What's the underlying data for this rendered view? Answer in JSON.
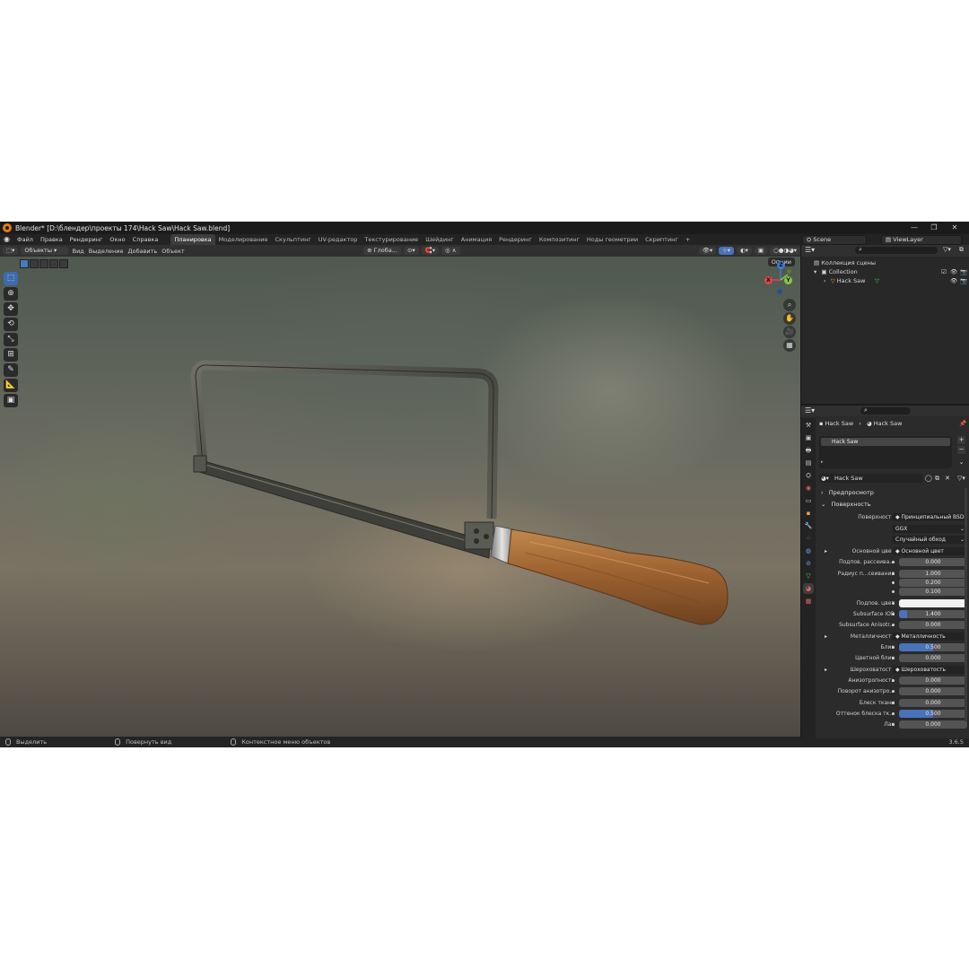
{
  "title": "Blender* [D:\\блендер\\проекты 174\\Hack Saw\\Hack Saw.blend]",
  "menu": [
    "Файл",
    "Правка",
    "Рендеринг",
    "Окно",
    "Справка"
  ],
  "workspaces": [
    "Планировка",
    "Моделирование",
    "Скульптинг",
    "UV-редактор",
    "Текстурирование",
    "Шейдинг",
    "Анимация",
    "Рендеринг",
    "Композитинг",
    "Ноды геометрии",
    "Скриптинг"
  ],
  "add_tab": "+",
  "scene": "Scene",
  "view_layer": "ViewLayer",
  "header3d": {
    "mode": "Объекты",
    "menus": [
      "Вид",
      "Выделение",
      "Добавить",
      "Объект"
    ],
    "transform": "Глоба...",
    "options": "Опции"
  },
  "gizmo": {
    "x": "X",
    "y": "Y",
    "z": "Z"
  },
  "outliner": {
    "scene_collection": "Коллекция сцены",
    "collection": "Collection",
    "object": "Hack Saw"
  },
  "properties": {
    "breadcrumb_object": "Hack Saw",
    "breadcrumb_material": "Hack Saw",
    "slot": "Hack Saw",
    "material_name": "Hack Saw",
    "preview": "Предпросмотр",
    "surface": "Поверхность",
    "rows": [
      {
        "label": "Поверхность",
        "value": "Принципиальный BSDF",
        "kind": "link"
      },
      {
        "label": "",
        "value": "GGX",
        "kind": "drop"
      },
      {
        "label": "",
        "value": "Случайный обход",
        "kind": "drop"
      },
      {
        "label": "Основной цвет",
        "value": "Основной цвет",
        "kind": "link"
      },
      {
        "label": "Подпов. рассеива...",
        "value": "0.000",
        "kind": "num",
        "fill": 0
      },
      {
        "label": "Радиус п...сеивания",
        "value": "1.000",
        "kind": "num",
        "fill": 0
      },
      {
        "label": "",
        "value": "0.200",
        "kind": "num",
        "fill": 0
      },
      {
        "label": "",
        "value": "0.100",
        "kind": "num",
        "fill": 0
      },
      {
        "label": "Подпов. цвет",
        "value": "",
        "kind": "color"
      },
      {
        "label": "Subsurface IOR",
        "value": "1.400",
        "kind": "num",
        "fill": 0.12
      },
      {
        "label": "Subsurface Anisotr...",
        "value": "0.000",
        "kind": "num",
        "fill": 0
      },
      {
        "label": "Металличность",
        "value": "Металличность",
        "kind": "link"
      },
      {
        "label": "Блик",
        "value": "0.500",
        "kind": "num",
        "fill": 0.5
      },
      {
        "label": "Цветной блик",
        "value": "0.000",
        "kind": "num",
        "fill": 0
      },
      {
        "label": "Шероховатость",
        "value": "Шероховатость",
        "kind": "link"
      },
      {
        "label": "Анизотропность",
        "value": "0.000",
        "kind": "num",
        "fill": 0
      },
      {
        "label": "Поворот анизотро...",
        "value": "0.000",
        "kind": "num",
        "fill": 0
      },
      {
        "label": "Блеск ткани",
        "value": "0.000",
        "kind": "num",
        "fill": 0
      },
      {
        "label": "Оттенок блеска тк...",
        "value": "0.500",
        "kind": "num",
        "fill": 0.5
      },
      {
        "label": "Лак",
        "value": "0.000",
        "kind": "num",
        "fill": 0
      }
    ]
  },
  "status": {
    "select": "Выделить",
    "rotate": "Повернуть вид",
    "context": "Контекстное меню объектов",
    "version": "3.6.5"
  },
  "colors": {
    "accent": "#4a72b8",
    "active_tool": "#3c6bb0",
    "x_axis": "#e0434f",
    "y_axis": "#8bc43f",
    "z_axis": "#3d7ad6"
  }
}
